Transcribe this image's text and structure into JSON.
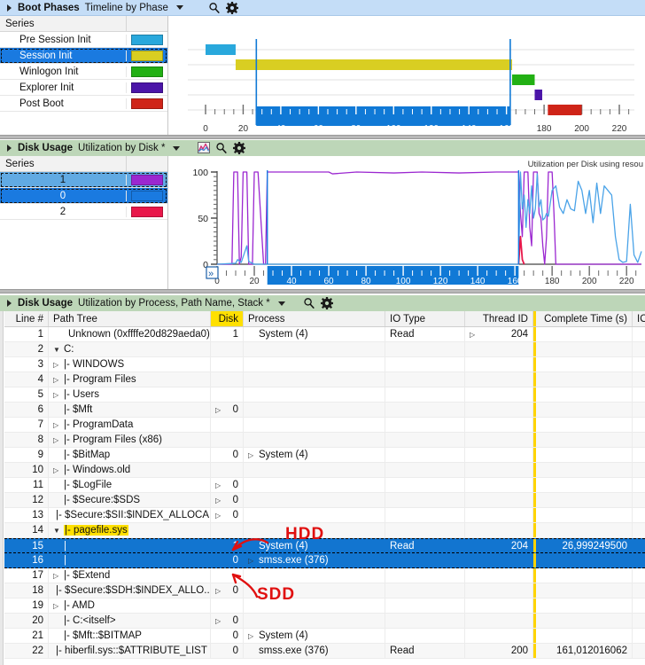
{
  "panels": {
    "boot": {
      "title": "Boot Phases",
      "subtitle": "Timeline by Phase",
      "icons": [
        "search-icon",
        "gear-icon"
      ],
      "series_header": "Series",
      "series": [
        {
          "label": "Pre Session Init",
          "color": "#29a8dc",
          "selected": false
        },
        {
          "label": "Session Init",
          "color": "#d9ce22",
          "selected": true
        },
        {
          "label": "Winlogon Init",
          "color": "#22b014",
          "selected": false
        },
        {
          "label": "Explorer Init",
          "color": "#4b15a8",
          "selected": false
        },
        {
          "label": "Post Boot",
          "color": "#cf2418",
          "selected": false
        }
      ]
    },
    "disk_util": {
      "title": "Disk Usage",
      "subtitle": "Utilization by Disk *",
      "icons": [
        "chart-icon",
        "search-icon",
        "gear-icon"
      ],
      "series_header": "Series",
      "graph_caption": "Utilization per Disk using resou",
      "series": [
        {
          "label": "1",
          "color": "#9b27d0",
          "state": "selected-light"
        },
        {
          "label": "0",
          "color": "#1a7ae0",
          "state": "selected"
        },
        {
          "label": "2",
          "color": "#e8174a",
          "state": "none"
        }
      ]
    },
    "disk_table": {
      "title": "Disk Usage",
      "subtitle": "Utilization by Process, Path Name, Stack *",
      "icons": [
        "search-icon",
        "gear-icon"
      ]
    }
  },
  "chart_data": [
    {
      "type": "bar",
      "name": "boot-phases-timeline",
      "title": "Timeline by Phase",
      "xlabel": "",
      "ylabel": "",
      "xlim": [
        0,
        228
      ],
      "ticks": [
        0,
        20,
        40,
        60,
        80,
        100,
        120,
        140,
        160,
        180,
        200,
        220
      ],
      "selection_range": [
        27,
        162
      ],
      "bars": [
        {
          "label": "Pre Session Init",
          "start": 0,
          "end": 16,
          "color": "#29a8dc"
        },
        {
          "label": "Session Init",
          "start": 16,
          "end": 163,
          "color": "#d9ce22"
        },
        {
          "label": "Winlogon Init",
          "start": 163,
          "end": 175,
          "color": "#22b014"
        },
        {
          "label": "Explorer Init",
          "start": 175,
          "end": 179,
          "color": "#4b15a8"
        },
        {
          "label": "Post Boot",
          "start": 182,
          "end": 200,
          "color": "#cf2418"
        }
      ]
    },
    {
      "type": "line",
      "name": "disk-utilization",
      "title": "Utilization per Disk using resou",
      "xlabel": "",
      "ylabel": "",
      "ylim": [
        0,
        100
      ],
      "ytick_labels": [
        "0",
        "50",
        "100"
      ],
      "xlim": [
        0,
        228
      ],
      "xtick_labels": [
        "0",
        "20",
        "40",
        "60",
        "80",
        "100",
        "120",
        "140",
        "160",
        "180",
        "200",
        "220"
      ],
      "selection_range": [
        27,
        162
      ],
      "series": [
        {
          "name": "1",
          "color": "#9b27d0",
          "points": [
            [
              0,
              0
            ],
            [
              8,
              0
            ],
            [
              9,
              100
            ],
            [
              11,
              100
            ],
            [
              12,
              0
            ],
            [
              13,
              8
            ],
            [
              14,
              100
            ],
            [
              16,
              100
            ],
            [
              17,
              0
            ],
            [
              18,
              0
            ],
            [
              19,
              0
            ],
            [
              20,
              100
            ],
            [
              22,
              100
            ],
            [
              25,
              0
            ],
            [
              26,
              0
            ],
            [
              27,
              100
            ],
            [
              30,
              100
            ],
            [
              60,
              100
            ],
            [
              62,
              98
            ],
            [
              75,
              100
            ],
            [
              95,
              99
            ],
            [
              110,
              100
            ],
            [
              130,
              99
            ],
            [
              150,
              100
            ],
            [
              160,
              100
            ],
            [
              162,
              100
            ],
            [
              163,
              55
            ],
            [
              164,
              30
            ],
            [
              165,
              100
            ],
            [
              167,
              100
            ],
            [
              168,
              40
            ],
            [
              169,
              20
            ],
            [
              170,
              100
            ],
            [
              172,
              100
            ],
            [
              173,
              55
            ],
            [
              174,
              50
            ],
            [
              175,
              20
            ],
            [
              176,
              0
            ],
            [
              177,
              30
            ],
            [
              178,
              100
            ],
            [
              180,
              100
            ],
            [
              181,
              55
            ],
            [
              182,
              0
            ],
            [
              185,
              0
            ],
            [
              228,
              0
            ]
          ]
        },
        {
          "name": "0",
          "color": "#4aa3e8",
          "points": [
            [
              0,
              0
            ],
            [
              10,
              1
            ],
            [
              11,
              5
            ],
            [
              13,
              2
            ],
            [
              16,
              20
            ],
            [
              17,
              3
            ],
            [
              20,
              0
            ],
            [
              40,
              0
            ],
            [
              90,
              0
            ],
            [
              140,
              0
            ],
            [
              160,
              0
            ],
            [
              162,
              0
            ],
            [
              163,
              100
            ],
            [
              164,
              60
            ],
            [
              165,
              75
            ],
            [
              166,
              40
            ],
            [
              167,
              70
            ],
            [
              168,
              55
            ],
            [
              169,
              85
            ],
            [
              170,
              50
            ],
            [
              171,
              60
            ],
            [
              172,
              98
            ],
            [
              173,
              62
            ],
            [
              174,
              70
            ],
            [
              175,
              48
            ],
            [
              176,
              50
            ],
            [
              177,
              55
            ],
            [
              178,
              52
            ],
            [
              180,
              80
            ],
            [
              182,
              85
            ],
            [
              184,
              62
            ],
            [
              186,
              55
            ],
            [
              188,
              70
            ],
            [
              190,
              60
            ],
            [
              192,
              58
            ],
            [
              194,
              90
            ],
            [
              196,
              80
            ],
            [
              198,
              55
            ],
            [
              200,
              80
            ],
            [
              202,
              45
            ],
            [
              204,
              88
            ],
            [
              206,
              55
            ],
            [
              208,
              85
            ],
            [
              210,
              80
            ],
            [
              212,
              75
            ],
            [
              214,
              30
            ],
            [
              216,
              5
            ],
            [
              218,
              2
            ],
            [
              220,
              3
            ],
            [
              222,
              65
            ],
            [
              224,
              10
            ],
            [
              226,
              2
            ],
            [
              228,
              14
            ]
          ]
        },
        {
          "name": "2",
          "color": "#e8174a",
          "points": [
            [
              162,
              0
            ],
            [
              163,
              30
            ],
            [
              164,
              5
            ],
            [
              165,
              0
            ]
          ]
        }
      ]
    }
  ],
  "table": {
    "columns": [
      {
        "key": "line",
        "label": "Line #",
        "width": 50,
        "align": "right"
      },
      {
        "key": "path",
        "label": "Path Tree",
        "width": 183,
        "align": "left"
      },
      {
        "key": "disk",
        "label": "Disk",
        "width": 37,
        "align": "right",
        "highlight": true
      },
      {
        "key": "process",
        "label": "Process",
        "width": 160,
        "align": "left"
      },
      {
        "key": "io_type",
        "label": "IO Type",
        "width": 90,
        "align": "left"
      },
      {
        "key": "thread_id",
        "label": "Thread ID",
        "width": 77,
        "align": "right"
      },
      {
        "key": "complete_time",
        "label": "Complete Time (s)",
        "width": 112,
        "align": "right",
        "yellowbar": true
      },
      {
        "key": "io_tail",
        "label": "IO T",
        "width": 19,
        "align": "left"
      }
    ],
    "rows": [
      {
        "line": "1",
        "indent": 1,
        "expander": "",
        "path": "Unknown (0xffffe20d829aeda0)",
        "disk": "1",
        "process": "System (4)",
        "process_expander": false,
        "io_type": "Read",
        "thread_id": "204",
        "thread_expander": true,
        "complete_time": "",
        "selected": false
      },
      {
        "line": "2",
        "indent": 0,
        "expander": "down",
        "path": "C:",
        "disk": "",
        "process": "",
        "process_expander": false,
        "io_type": "",
        "thread_id": "",
        "thread_expander": false,
        "complete_time": "",
        "selected": false
      },
      {
        "line": "3",
        "indent": 0,
        "expander": "right",
        "path": "|- WINDOWS",
        "disk": "",
        "process": "",
        "process_expander": false,
        "io_type": "",
        "thread_id": "",
        "thread_expander": false,
        "complete_time": "",
        "selected": false
      },
      {
        "line": "4",
        "indent": 0,
        "expander": "right",
        "path": "|- Program Files",
        "disk": "",
        "process": "",
        "process_expander": false,
        "io_type": "",
        "thread_id": "",
        "thread_expander": false,
        "complete_time": "",
        "selected": false
      },
      {
        "line": "5",
        "indent": 0,
        "expander": "right",
        "path": "|- Users",
        "disk": "",
        "process": "",
        "process_expander": false,
        "io_type": "",
        "thread_id": "",
        "thread_expander": false,
        "complete_time": "",
        "selected": false
      },
      {
        "line": "6",
        "indent": 0,
        "expander": "",
        "path": "|- $Mft",
        "disk": "0",
        "disk_expander": true,
        "process": "",
        "process_expander": false,
        "io_type": "",
        "thread_id": "",
        "thread_expander": false,
        "complete_time": "",
        "selected": false
      },
      {
        "line": "7",
        "indent": 0,
        "expander": "right",
        "path": "|- ProgramData",
        "disk": "",
        "process": "",
        "process_expander": false,
        "io_type": "",
        "thread_id": "",
        "thread_expander": false,
        "complete_time": "",
        "selected": false
      },
      {
        "line": "8",
        "indent": 0,
        "expander": "right",
        "path": "|- Program Files (x86)",
        "disk": "",
        "process": "",
        "process_expander": false,
        "io_type": "",
        "thread_id": "",
        "thread_expander": false,
        "complete_time": "",
        "selected": false
      },
      {
        "line": "9",
        "indent": 0,
        "expander": "",
        "path": "|- $BitMap",
        "disk": "0",
        "process": "System (4)",
        "process_expander": true,
        "io_type": "",
        "thread_id": "",
        "thread_expander": false,
        "complete_time": "",
        "selected": false
      },
      {
        "line": "10",
        "indent": 0,
        "expander": "right",
        "path": "|- Windows.old",
        "disk": "",
        "process": "",
        "process_expander": false,
        "io_type": "",
        "thread_id": "",
        "thread_expander": false,
        "complete_time": "",
        "selected": false
      },
      {
        "line": "11",
        "indent": 0,
        "expander": "",
        "path": "|- $LogFile",
        "disk": "0",
        "disk_expander": true,
        "process": "",
        "process_expander": false,
        "io_type": "",
        "thread_id": "",
        "thread_expander": false,
        "complete_time": "",
        "selected": false
      },
      {
        "line": "12",
        "indent": 0,
        "expander": "",
        "path": "|- $Secure:$SDS",
        "disk": "0",
        "disk_expander": true,
        "process": "",
        "process_expander": false,
        "io_type": "",
        "thread_id": "",
        "thread_expander": false,
        "complete_time": "",
        "selected": false
      },
      {
        "line": "13",
        "indent": 0,
        "expander": "",
        "path": "|- $Secure:$SII:$INDEX_ALLOCA...",
        "disk": "0",
        "disk_expander": true,
        "process": "",
        "process_expander": false,
        "io_type": "",
        "thread_id": "",
        "thread_expander": false,
        "complete_time": "",
        "selected": false
      },
      {
        "line": "14",
        "indent": 0,
        "expander": "down",
        "path": "|- pagefile.sys",
        "path_highlight": true,
        "disk": "",
        "process": "",
        "process_expander": false,
        "io_type": "",
        "thread_id": "",
        "thread_expander": false,
        "complete_time": "",
        "selected": false
      },
      {
        "line": "15",
        "indent": 0,
        "expander": "",
        "path": "|",
        "disk": "1",
        "process": "System (4)",
        "process_expander": false,
        "io_type": "Read",
        "thread_id": "204",
        "thread_expander": false,
        "complete_time": "26,999249500",
        "selected": true
      },
      {
        "line": "16",
        "indent": 0,
        "expander": "",
        "path": "|",
        "disk": "0",
        "process": "smss.exe (376)",
        "process_expander": true,
        "io_type": "",
        "thread_id": "",
        "thread_expander": false,
        "complete_time": "",
        "selected": true
      },
      {
        "line": "17",
        "indent": 0,
        "expander": "right",
        "path": "|- $Extend",
        "disk": "",
        "process": "",
        "process_expander": false,
        "io_type": "",
        "thread_id": "",
        "thread_expander": false,
        "complete_time": "",
        "selected": false
      },
      {
        "line": "18",
        "indent": 0,
        "expander": "",
        "path": "|- $Secure:$SDH:$INDEX_ALLO...",
        "disk": "0",
        "disk_expander": true,
        "process": "",
        "process_expander": false,
        "io_type": "",
        "thread_id": "",
        "thread_expander": false,
        "complete_time": "",
        "selected": false
      },
      {
        "line": "19",
        "indent": 0,
        "expander": "right",
        "path": "|- AMD",
        "disk": "",
        "process": "",
        "process_expander": false,
        "io_type": "",
        "thread_id": "",
        "thread_expander": false,
        "complete_time": "",
        "selected": false
      },
      {
        "line": "20",
        "indent": 0,
        "expander": "",
        "path": "|- C:<itself>",
        "disk": "0",
        "disk_expander": true,
        "process": "",
        "process_expander": false,
        "io_type": "",
        "thread_id": "",
        "thread_expander": false,
        "complete_time": "",
        "selected": false
      },
      {
        "line": "21",
        "indent": 0,
        "expander": "",
        "path": "|- $Mft::$BITMAP",
        "disk": "0",
        "process": "System (4)",
        "process_expander": true,
        "io_type": "",
        "thread_id": "",
        "thread_expander": false,
        "complete_time": "",
        "selected": false
      },
      {
        "line": "22",
        "indent": 0,
        "expander": "",
        "path": "|- hiberfil.sys::$ATTRIBUTE_LIST",
        "disk": "0",
        "process": "smss.exe (376)",
        "process_expander": false,
        "io_type": "Read",
        "thread_id": "200",
        "thread_expander": false,
        "complete_time": "161,012016062",
        "selected": false
      }
    ]
  },
  "annotations": [
    {
      "name": "hdd-annotation",
      "text": "HDD",
      "color": "#e01010"
    },
    {
      "name": "sdd-annotation",
      "text": "SDD",
      "color": "#e01010"
    }
  ]
}
